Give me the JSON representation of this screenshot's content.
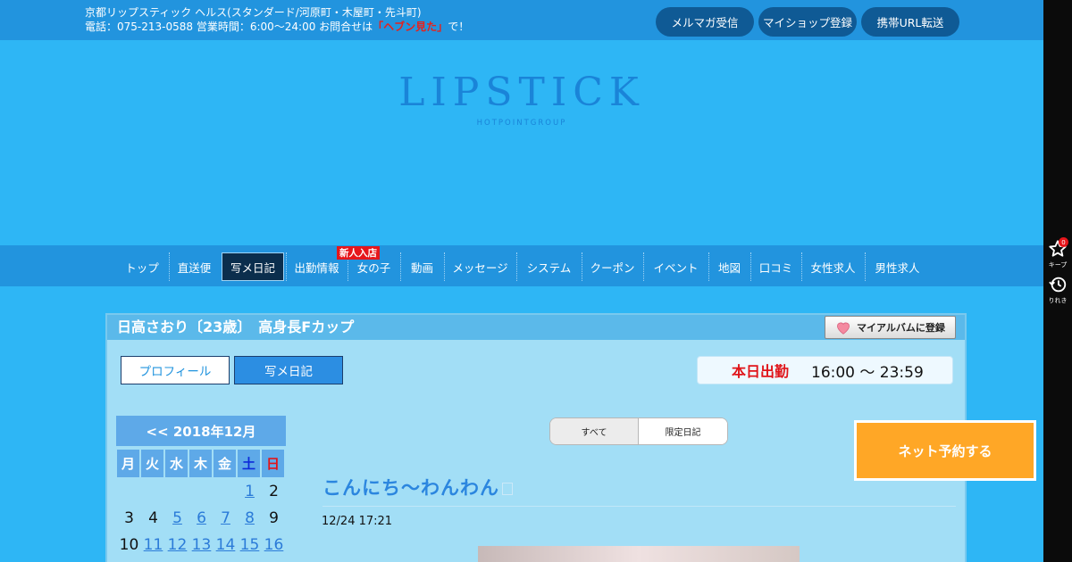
{
  "topbar": {
    "line1": "京都リップスティック ヘルス(スタンダード/河原町・木屋町・先斗町)",
    "line2_prefix": "電話：075-213-0588 営業時間：6:00～24:00 お問合せは",
    "line2_phrase": "「ヘブン見た」",
    "line2_suffix": "で！",
    "buttons": [
      "メルマガ受信",
      "マイショップ登録",
      "携帯URL転送"
    ]
  },
  "logo": {
    "title": "LIPSTICK",
    "subtitle": "HOTPOINTGROUP"
  },
  "nav": {
    "items": [
      "トップ",
      "直送便",
      "写メ日記",
      "出勤情報",
      "女の子",
      "動画",
      "メッセージ",
      "システム",
      "クーポン",
      "イベント",
      "地図",
      "口コミ",
      "女性求人",
      "男性求人"
    ],
    "active": "写メ日記",
    "badge": "新人入店"
  },
  "side": {
    "keep_label": "キープ",
    "keep_count": "0",
    "history_label": "りれき"
  },
  "profile": {
    "title": "日高さおり〔23歳〕　高身長Fカップ",
    "album_button": "マイアルバムに登録",
    "tabs": [
      "プロフィール",
      "写メ日記"
    ],
    "active_tab": "写メ日記",
    "today_label": "本日出勤",
    "today_time": "16:00 ～ 23:59"
  },
  "calendar": {
    "header": "<< 2018年12月",
    "weekdays": [
      "月",
      "火",
      "水",
      "木",
      "金",
      "土",
      "日"
    ],
    "rows": [
      [
        {
          "d": "",
          "link": false
        },
        {
          "d": "",
          "link": false
        },
        {
          "d": "",
          "link": false
        },
        {
          "d": "",
          "link": false
        },
        {
          "d": "",
          "link": false
        },
        {
          "d": "1",
          "link": true
        },
        {
          "d": "2",
          "link": false
        }
      ],
      [
        {
          "d": "3",
          "link": false
        },
        {
          "d": "4",
          "link": false
        },
        {
          "d": "5",
          "link": true
        },
        {
          "d": "6",
          "link": true
        },
        {
          "d": "7",
          "link": true
        },
        {
          "d": "8",
          "link": true
        },
        {
          "d": "9",
          "link": false
        }
      ],
      [
        {
          "d": "10",
          "link": false
        },
        {
          "d": "11",
          "link": true
        },
        {
          "d": "12",
          "link": true
        },
        {
          "d": "13",
          "link": true
        },
        {
          "d": "14",
          "link": true
        },
        {
          "d": "15",
          "link": true
        },
        {
          "d": "16",
          "link": true
        }
      ]
    ]
  },
  "diary": {
    "filters": [
      "すべて",
      "限定日記"
    ],
    "post_title": "こんにち～わんわん",
    "post_date": "12/24 17:21"
  },
  "reserve": {
    "label": "ネット予約する"
  },
  "colors": {
    "background": "#2eb6f5",
    "bar": "#2294de",
    "accent": "#e0151a",
    "reserve": "#ffa726"
  }
}
